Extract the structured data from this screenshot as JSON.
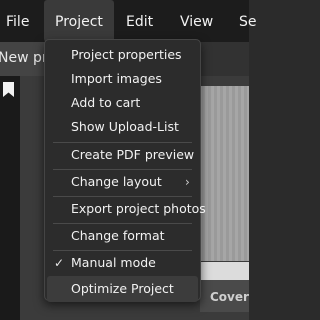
{
  "menubar": {
    "items": [
      {
        "label": "File"
      },
      {
        "label": "Project"
      },
      {
        "label": "Edit"
      },
      {
        "label": "View"
      },
      {
        "label": "Se"
      }
    ]
  },
  "tab": {
    "label": "New pr"
  },
  "canvas": {
    "cover_label": "Cover"
  },
  "dropdown": {
    "items": [
      {
        "label": "Project properties"
      },
      {
        "label": "Import images"
      },
      {
        "label": "Add to cart"
      },
      {
        "label": "Show Upload-List"
      },
      {
        "label": "Create PDF preview"
      },
      {
        "label": "Change layout",
        "submenu_icon": "chevron-right-icon"
      },
      {
        "label": "Export project photos"
      },
      {
        "label": "Change format"
      },
      {
        "label": "Manual mode",
        "checked": true,
        "check_icon": "checkmark-icon"
      },
      {
        "label": "Optimize Project",
        "highlighted": true
      }
    ]
  }
}
